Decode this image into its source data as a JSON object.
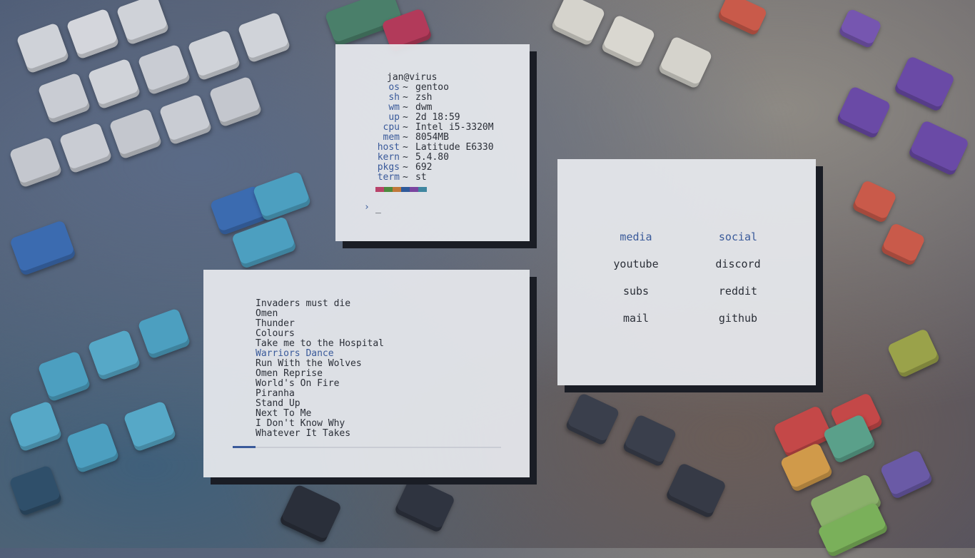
{
  "fetch": {
    "user": "jan@virus",
    "rows": [
      {
        "key": "os",
        "value": "gentoo"
      },
      {
        "key": "sh",
        "value": "zsh"
      },
      {
        "key": "wm",
        "value": "dwm"
      },
      {
        "key": "up",
        "value": "2d 18:59"
      },
      {
        "key": "cpu",
        "value": "Intel i5-3320M"
      },
      {
        "key": "mem",
        "value": "8054MB"
      },
      {
        "key": "host",
        "value": "Latitude E6330"
      },
      {
        "key": "kern",
        "value": "5.4.80"
      },
      {
        "key": "pkgs",
        "value": "692"
      },
      {
        "key": "term",
        "value": "st"
      }
    ],
    "separator": "~",
    "palette": [
      "#b8436a",
      "#4e8a3e",
      "#c0783a",
      "#2f5a9a",
      "#7a45a0",
      "#3f86a0"
    ],
    "prompt_symbol": "›",
    "cursor": "_"
  },
  "playlist": {
    "tracks": [
      "Invaders must die",
      "Omen",
      "Thunder",
      "Colours",
      "Take me to the Hospital",
      "Warriors Dance",
      "Run With the Wolves",
      "Omen Reprise",
      "World's On Fire",
      "Piranha",
      "Stand Up",
      "Next To Me",
      "I Don't Know Why",
      "Whatever It Takes"
    ],
    "active_index": 5,
    "progress_fraction": 0.085
  },
  "links": {
    "columns": [
      {
        "heading": "media",
        "items": [
          "youtube",
          "subs",
          "mail"
        ]
      },
      {
        "heading": "social",
        "items": [
          "discord",
          "reddit",
          "github"
        ]
      }
    ]
  }
}
